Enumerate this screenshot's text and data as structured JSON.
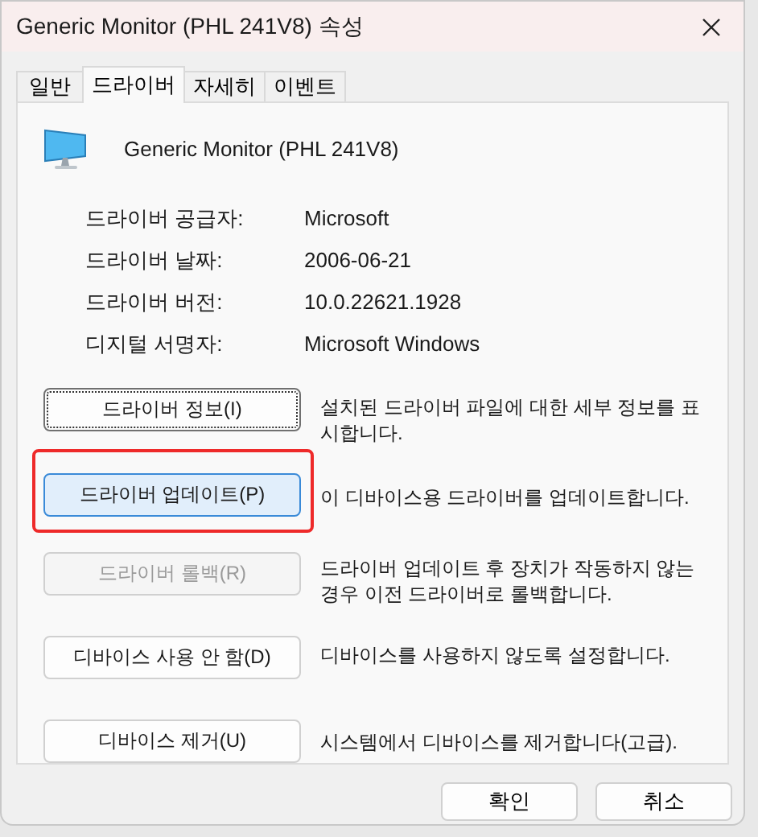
{
  "window": {
    "title": "Generic Monitor (PHL 241V8) 속성"
  },
  "tabs": [
    {
      "label": "일반",
      "selected": false
    },
    {
      "label": "드라이버",
      "selected": true
    },
    {
      "label": "자세히",
      "selected": false
    },
    {
      "label": "이벤트",
      "selected": false
    }
  ],
  "device": {
    "name": "Generic Monitor (PHL 241V8)"
  },
  "properties": [
    {
      "label": "드라이버 공급자:",
      "value": "Microsoft"
    },
    {
      "label": "드라이버 날짜:",
      "value": "2006-06-21"
    },
    {
      "label": "드라이버 버전:",
      "value": "10.0.22621.1928"
    },
    {
      "label": "디지털 서명자:",
      "value": "Microsoft Windows"
    }
  ],
  "actions": [
    {
      "label": "드라이버 정보(I)",
      "description": "설치된 드라이버 파일에 대한 세부 정보를 표시합니다.",
      "disabled": false,
      "focused": true,
      "highlighted": false
    },
    {
      "label": "드라이버 업데이트(P)",
      "description": "이 디바이스용 드라이버를 업데이트합니다.",
      "disabled": false,
      "focused": false,
      "highlighted": true
    },
    {
      "label": "드라이버 롤백(R)",
      "description": "드라이버 업데이트 후 장치가 작동하지 않는 경우 이전 드라이버로 롤백합니다.",
      "disabled": true,
      "focused": false,
      "highlighted": false
    },
    {
      "label": "디바이스 사용 안 함(D)",
      "description": "디바이스를 사용하지 않도록 설정합니다.",
      "disabled": false,
      "focused": false,
      "highlighted": false
    },
    {
      "label": "디바이스 제거(U)",
      "description": "시스템에서 디바이스를 제거합니다(고급).",
      "disabled": false,
      "focused": false,
      "highlighted": false
    }
  ],
  "buttons": [
    "확인",
    "취소"
  ]
}
